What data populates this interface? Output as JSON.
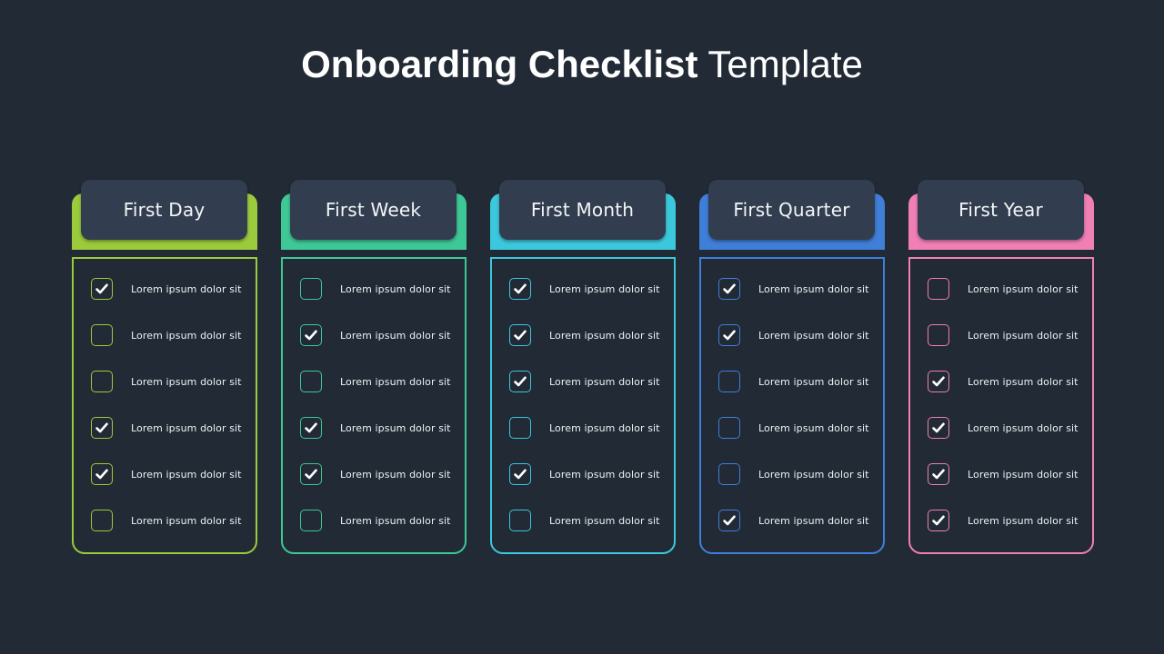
{
  "title": {
    "bold": "Onboarding Checklist",
    "light": " Template"
  },
  "columns": [
    {
      "id": "first-day",
      "label": "First Day",
      "color": "#9bcb3c",
      "items": [
        {
          "text": "Lorem ipsum dolor sit",
          "checked": true
        },
        {
          "text": "Lorem ipsum dolor sit",
          "checked": false
        },
        {
          "text": "Lorem ipsum dolor sit",
          "checked": false
        },
        {
          "text": "Lorem ipsum dolor sit",
          "checked": true
        },
        {
          "text": "Lorem ipsum dolor sit",
          "checked": true
        },
        {
          "text": "Lorem ipsum dolor sit",
          "checked": false
        }
      ]
    },
    {
      "id": "first-week",
      "label": "First Week",
      "color": "#3ec896",
      "items": [
        {
          "text": "Lorem ipsum dolor sit",
          "checked": false
        },
        {
          "text": "Lorem ipsum dolor sit",
          "checked": true
        },
        {
          "text": "Lorem ipsum dolor sit",
          "checked": false
        },
        {
          "text": "Lorem ipsum dolor sit",
          "checked": true
        },
        {
          "text": "Lorem ipsum dolor sit",
          "checked": true
        },
        {
          "text": "Lorem ipsum dolor sit",
          "checked": false
        }
      ]
    },
    {
      "id": "first-month",
      "label": "First Month",
      "color": "#3cc8dc",
      "items": [
        {
          "text": "Lorem ipsum dolor sit",
          "checked": true
        },
        {
          "text": "Lorem ipsum dolor sit",
          "checked": true
        },
        {
          "text": "Lorem ipsum dolor sit",
          "checked": true
        },
        {
          "text": "Lorem ipsum dolor sit",
          "checked": false
        },
        {
          "text": "Lorem ipsum dolor sit",
          "checked": true
        },
        {
          "text": "Lorem ipsum dolor sit",
          "checked": false
        }
      ]
    },
    {
      "id": "first-quarter",
      "label": "First Quarter",
      "color": "#3f7fd8",
      "items": [
        {
          "text": "Lorem ipsum dolor sit",
          "checked": true
        },
        {
          "text": "Lorem ipsum dolor sit",
          "checked": true
        },
        {
          "text": "Lorem ipsum dolor sit",
          "checked": false
        },
        {
          "text": "Lorem ipsum dolor sit",
          "checked": false
        },
        {
          "text": "Lorem ipsum dolor sit",
          "checked": false
        },
        {
          "text": "Lorem ipsum dolor sit",
          "checked": true
        }
      ]
    },
    {
      "id": "first-year",
      "label": "First Year",
      "color": "#f07fb5",
      "items": [
        {
          "text": "Lorem ipsum dolor sit",
          "checked": false
        },
        {
          "text": "Lorem ipsum dolor sit",
          "checked": false
        },
        {
          "text": "Lorem ipsum dolor sit",
          "checked": true
        },
        {
          "text": "Lorem ipsum dolor sit",
          "checked": true
        },
        {
          "text": "Lorem ipsum dolor sit",
          "checked": true
        },
        {
          "text": "Lorem ipsum dolor sit",
          "checked": true
        }
      ]
    }
  ]
}
